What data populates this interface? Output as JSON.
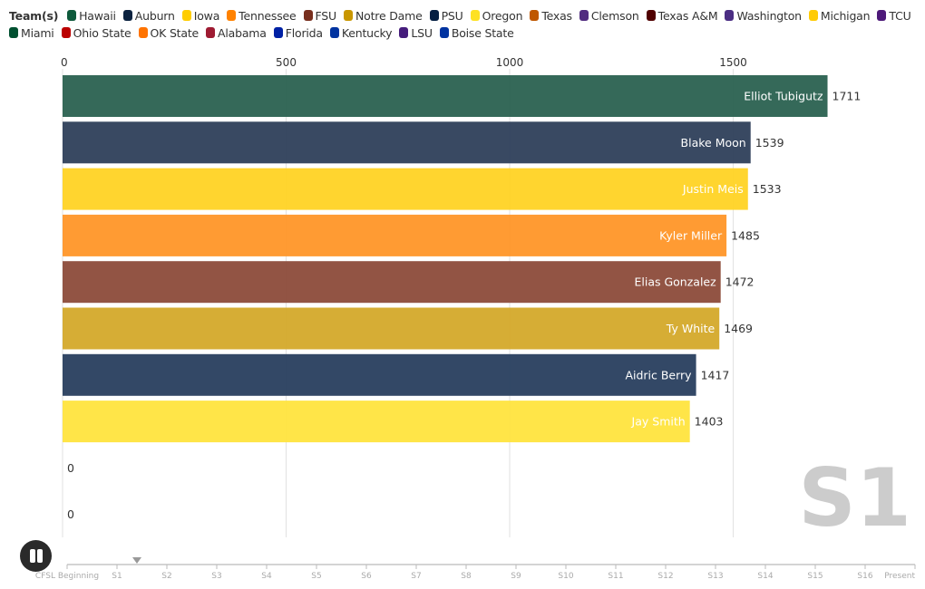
{
  "legend": {
    "title": "Team(s)",
    "items": [
      {
        "label": "Hawaii",
        "color": "#0e5a3c"
      },
      {
        "label": "Auburn",
        "color": "#0c2340"
      },
      {
        "label": "Iowa",
        "color": "#ffcd00"
      },
      {
        "label": "Tennessee",
        "color": "#ff8200"
      },
      {
        "label": "FSU",
        "color": "#782f1e"
      },
      {
        "label": "Notre Dame",
        "color": "#c99700"
      },
      {
        "label": "PSU",
        "color": "#041e42"
      },
      {
        "label": "Oregon",
        "color": "#fee123"
      },
      {
        "label": "Texas",
        "color": "#bf5700"
      },
      {
        "label": "Clemson",
        "color": "#522d80"
      },
      {
        "label": "Texas A&M",
        "color": "#500000"
      },
      {
        "label": "Washington",
        "color": "#4b2e83"
      },
      {
        "label": "Michigan",
        "color": "#ffcb05"
      },
      {
        "label": "TCU",
        "color": "#4d1979"
      },
      {
        "label": "Miami",
        "color": "#005030"
      },
      {
        "label": "Ohio State",
        "color": "#bb0000"
      },
      {
        "label": "OK State",
        "color": "#ff7300"
      },
      {
        "label": "Alabama",
        "color": "#9e1b32"
      },
      {
        "label": "Florida",
        "color": "#0021a5"
      },
      {
        "label": "Kentucky",
        "color": "#0033a0"
      },
      {
        "label": "LSU",
        "color": "#461d7c"
      },
      {
        "label": "Boise State",
        "color": "#0033a0"
      }
    ]
  },
  "chart_data": {
    "type": "bar",
    "orientation": "horizontal",
    "title": "",
    "xlabel": "",
    "ylabel": "",
    "xlim": [
      0,
      1780
    ],
    "x_ticks": [
      0,
      500,
      1000,
      1500
    ],
    "x_tick_labels": [
      "0",
      "500",
      "1000",
      "1500"
    ],
    "grid": true,
    "legend_position": "top",
    "current_period": "S1",
    "bars": [
      {
        "name": "Elliot Tubigutz",
        "value": 1711,
        "color": "#2a6150"
      },
      {
        "name": "Blake Moon",
        "value": 1539,
        "color": "#2e3f5a"
      },
      {
        "name": "Justin Meis",
        "value": 1533,
        "color": "#ffd324"
      },
      {
        "name": "Kyler Miller",
        "value": 1485,
        "color": "#ff9628"
      },
      {
        "name": "Elias Gonzalez",
        "value": 1472,
        "color": "#8c4b3a"
      },
      {
        "name": "Ty White",
        "value": 1469,
        "color": "#d4a92a"
      },
      {
        "name": "Aidric Berry",
        "value": 1417,
        "color": "#283e5e"
      },
      {
        "name": "Jay Smith",
        "value": 1403,
        "color": "#ffe43e"
      },
      {
        "name": "",
        "value": 0,
        "color": "#cccccc"
      },
      {
        "name": "",
        "value": 0,
        "color": "#cccccc"
      }
    ]
  },
  "timeline": {
    "labels": [
      "CFSL Beginning",
      "S1",
      "S2",
      "S3",
      "S4",
      "S5",
      "S6",
      "S7",
      "S8",
      "S9",
      "S10",
      "S11",
      "S12",
      "S13",
      "S14",
      "S15",
      "S16",
      "Present"
    ],
    "position": 1.4
  },
  "controls": {
    "play_state": "playing"
  }
}
